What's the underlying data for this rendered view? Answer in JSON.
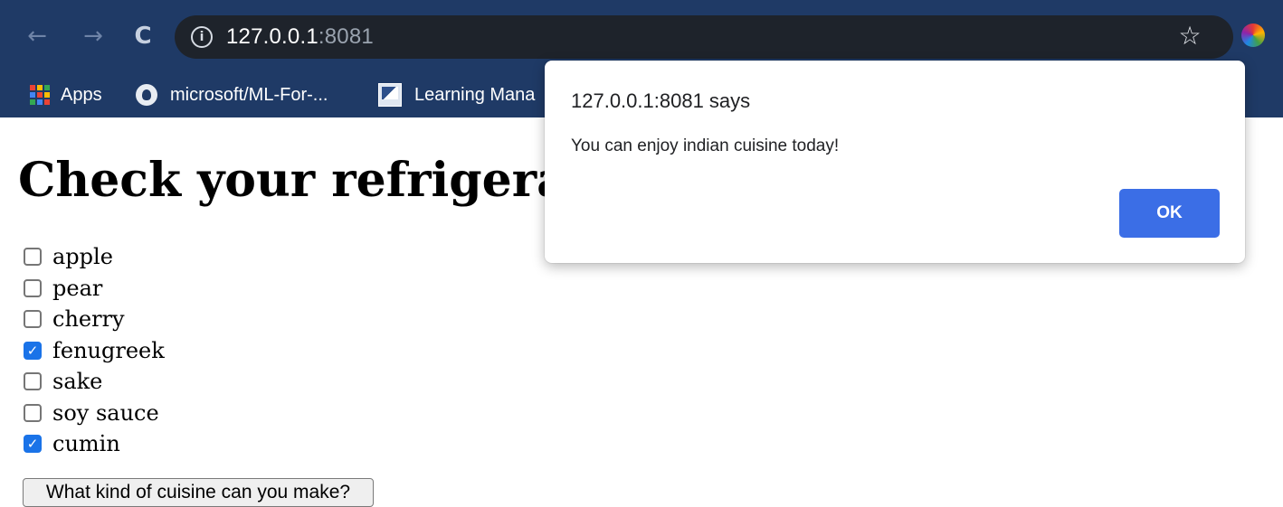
{
  "browser": {
    "url_host": "127.0.0.1",
    "url_port": ":8081",
    "info_icon": "info-icon",
    "back_icon": "←",
    "forward_icon": "→",
    "reload_icon": "C",
    "star_icon": "☆",
    "bookmarks": [
      {
        "label": "Apps",
        "icon": "apps-grid-icon"
      },
      {
        "label": "microsoft/ML-For-...",
        "icon": "github-icon"
      },
      {
        "label": "Learning Mana",
        "icon": "learning-manager-icon"
      }
    ]
  },
  "page": {
    "title": "Check your refrigerator.",
    "ingredients": [
      {
        "label": "apple",
        "checked": false
      },
      {
        "label": "pear",
        "checked": false
      },
      {
        "label": "cherry",
        "checked": false
      },
      {
        "label": "fenugreek",
        "checked": true
      },
      {
        "label": "sake",
        "checked": false
      },
      {
        "label": "soy sauce",
        "checked": false
      },
      {
        "label": "cumin",
        "checked": true
      }
    ],
    "button_label": "What kind of cuisine can you make?"
  },
  "alert": {
    "title": "127.0.0.1:8081 says",
    "message": "You can enjoy indian cuisine today!",
    "ok_label": "OK"
  },
  "colors": {
    "chrome_bg": "#1f3a66",
    "omnibox_bg": "#1e232b",
    "checkbox_checked": "#1a73e8",
    "ok_button": "#3b6ee6"
  }
}
